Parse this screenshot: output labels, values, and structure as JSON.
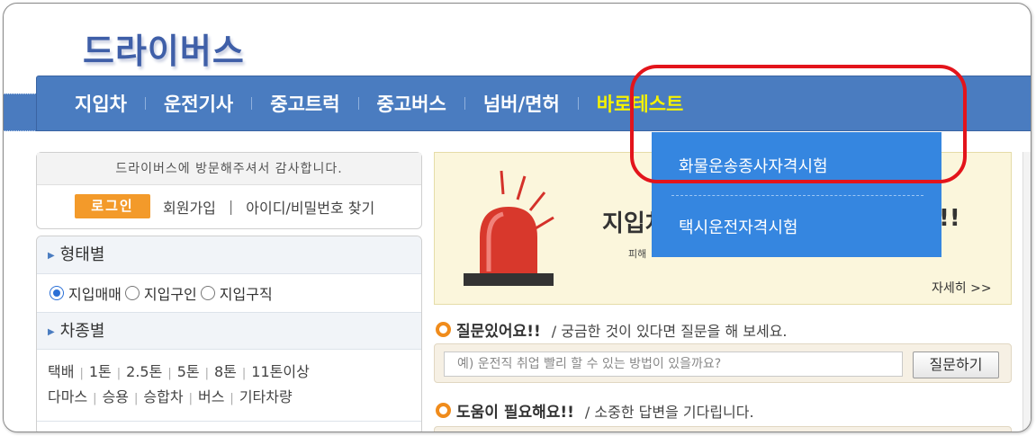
{
  "site": {
    "logo": "드라이버스"
  },
  "nav": {
    "items": [
      "지입차",
      "운전기사",
      "중고트럭",
      "중고버스",
      "넘버/면허",
      "바로테스트"
    ],
    "active_index": 5,
    "active_color": "#f6f200",
    "bar_color": "#4a7cc0"
  },
  "dropdown": {
    "items": [
      "화물운송종사자격시험",
      "택시운전자격시험"
    ],
    "bg_color": "#3586e0",
    "highlight_color": "#e3141b"
  },
  "login": {
    "welcome": "드라이버스에 방문해주셔서 감사합니다.",
    "login_button": "로그인",
    "signup": "회원가입",
    "separator": "|",
    "find_account": "아이디/비밀번호 찾기"
  },
  "filters": {
    "type_heading": "형태별",
    "type_options": [
      {
        "label": "지입매매",
        "selected": true
      },
      {
        "label": "지입구인",
        "selected": false
      },
      {
        "label": "지입구직",
        "selected": false
      }
    ],
    "vehicle_heading": "차종별",
    "vehicle_row1": [
      "택배",
      "1톤",
      "2.5톤",
      "5톤",
      "8톤",
      "11톤이상"
    ],
    "vehicle_row2": [
      "다마스",
      "승용",
      "승합차",
      "버스",
      "기타차량"
    ]
  },
  "banner": {
    "title": "지입차",
    "title_end": "!!",
    "subtitle": "피해",
    "more": "자세히 >>"
  },
  "question": {
    "title": "질문있어요!!",
    "desc": "/ 궁금한 것이 있다면 질문을 해 보세요.",
    "placeholder": "예) 운전직 취업 빨리 할 수 있는 방법이 있을까요?",
    "button": "질문하기"
  },
  "help": {
    "title": "도움이 필요해요!!",
    "desc": "/ 소중한 답변을 기다립니다."
  },
  "colors": {
    "accent_orange": "#f39a2a",
    "ring_orange": "#f08c1c"
  }
}
